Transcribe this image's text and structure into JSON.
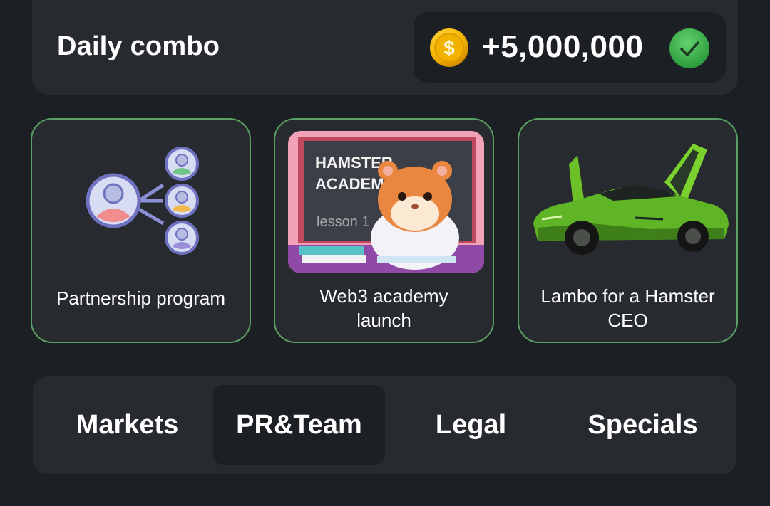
{
  "daily_combo": {
    "title": "Daily combo",
    "reward": "+5,000,000",
    "coin_symbol": "$",
    "status": "completed"
  },
  "cards": [
    {
      "label": "Partnership program",
      "icon": "partner-network-icon"
    },
    {
      "label": "Web3 academy\nlaunch",
      "image": "hamster-academy-image",
      "image_text": [
        "HAMSTER",
        "ACADEMY",
        "lesson 1"
      ]
    },
    {
      "label": "Lambo for a Hamster\nCEO",
      "image": "green-lambo-image"
    }
  ],
  "tabs": [
    {
      "label": "Markets",
      "selected": false
    },
    {
      "label": "PR&Team",
      "selected": true
    },
    {
      "label": "Legal",
      "selected": false
    },
    {
      "label": "Specials",
      "selected": false
    }
  ],
  "colors": {
    "background": "#1c1f24",
    "panel": "#272a2f",
    "card_border": "#5aa064",
    "accent_green": "#3fb34f",
    "coin_gold": "#f5c518"
  }
}
